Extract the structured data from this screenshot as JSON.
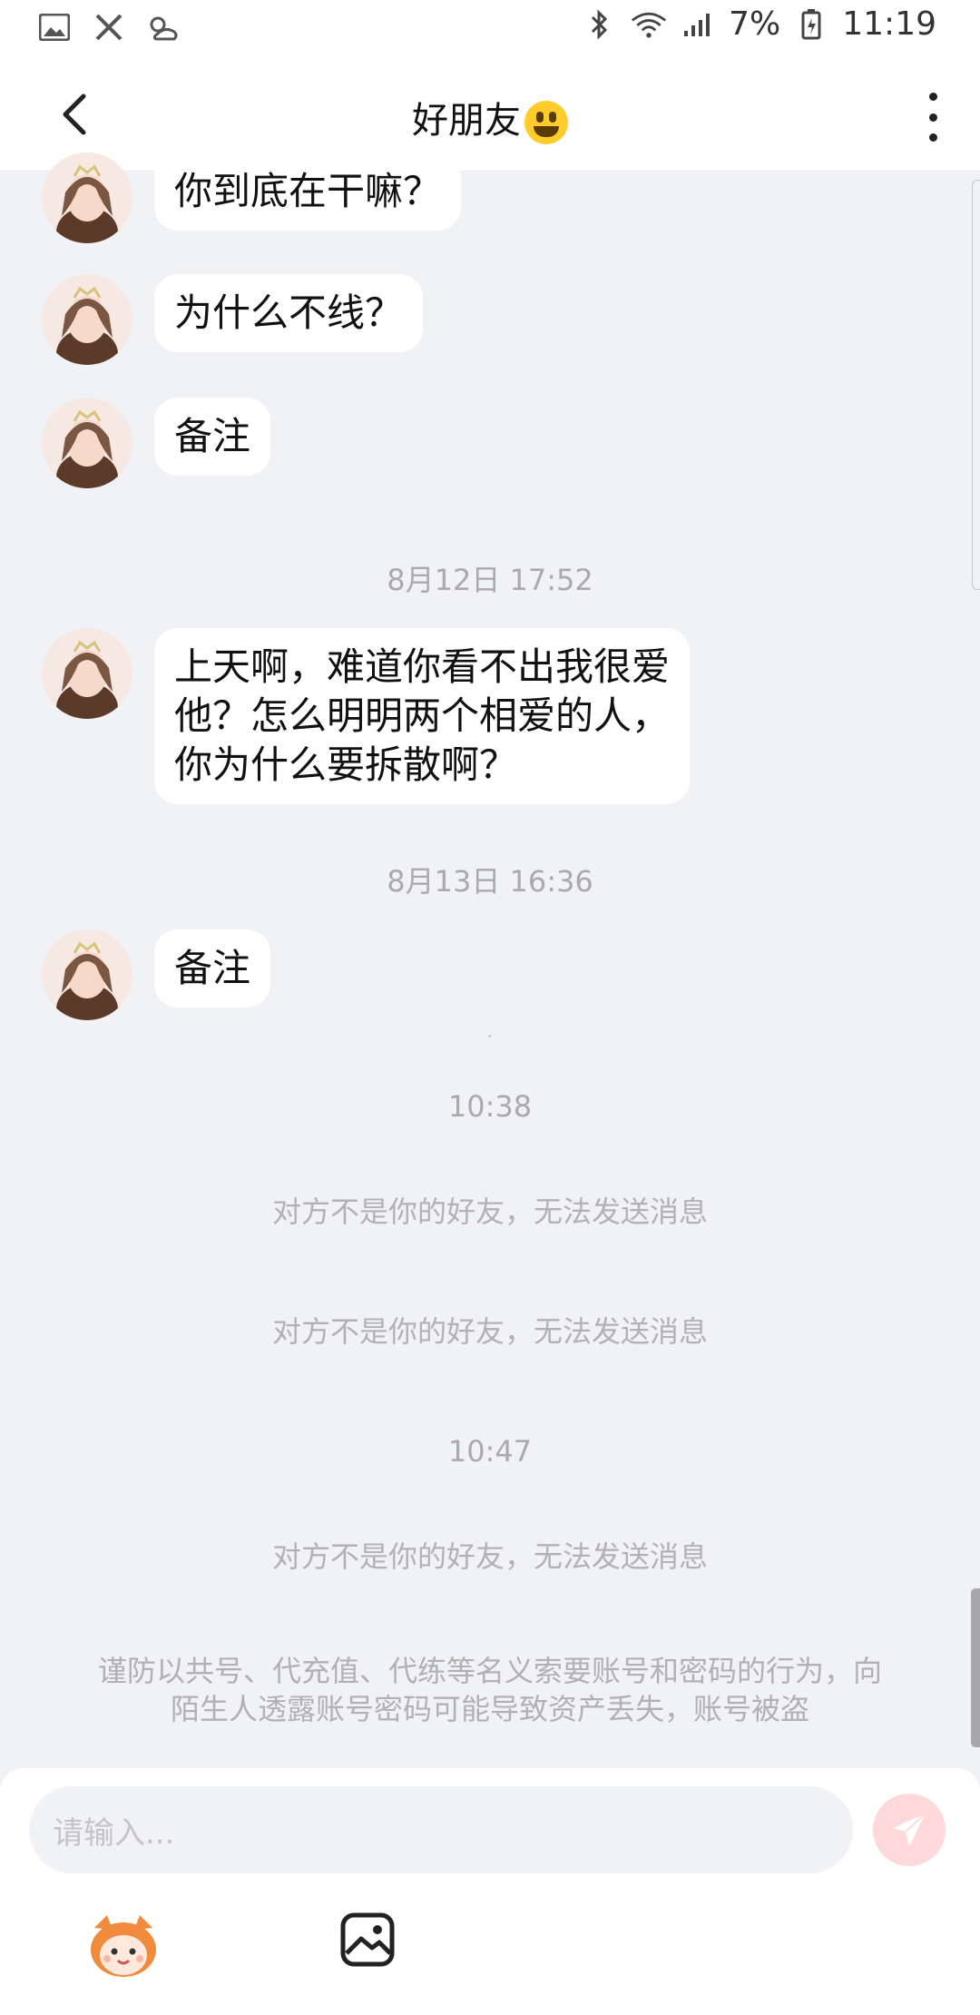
{
  "status": {
    "battery": "7%",
    "time": "11:19"
  },
  "header": {
    "title": "好朋友"
  },
  "messages": [
    {
      "text": "你到底在干嘛？"
    },
    {
      "text": "为什么不线？"
    },
    {
      "text": "备注"
    },
    {
      "text": "上天啊，难道你看不出我很爱\n他？怎么明明两个相爱的人，\n你为什么要拆散啊？"
    },
    {
      "text": "备注"
    }
  ],
  "timestamps": {
    "t1": "8月12日 17:52",
    "t2": "8月13日 16:36",
    "t3": "10:38",
    "t4": "10:47"
  },
  "system": {
    "not_friend": "对方不是你的好友，无法发送消息",
    "warning_line1": "谨防以共号、代充值、代练等名义索要账号和密码的行为，向",
    "warning_line2": "陌生人透露账号密码可能导致资产丢失，账号被盗"
  },
  "input": {
    "placeholder": "请输入..."
  },
  "colors": {
    "accent_send": "#ffd9d9",
    "background": "#f1f2f5"
  }
}
